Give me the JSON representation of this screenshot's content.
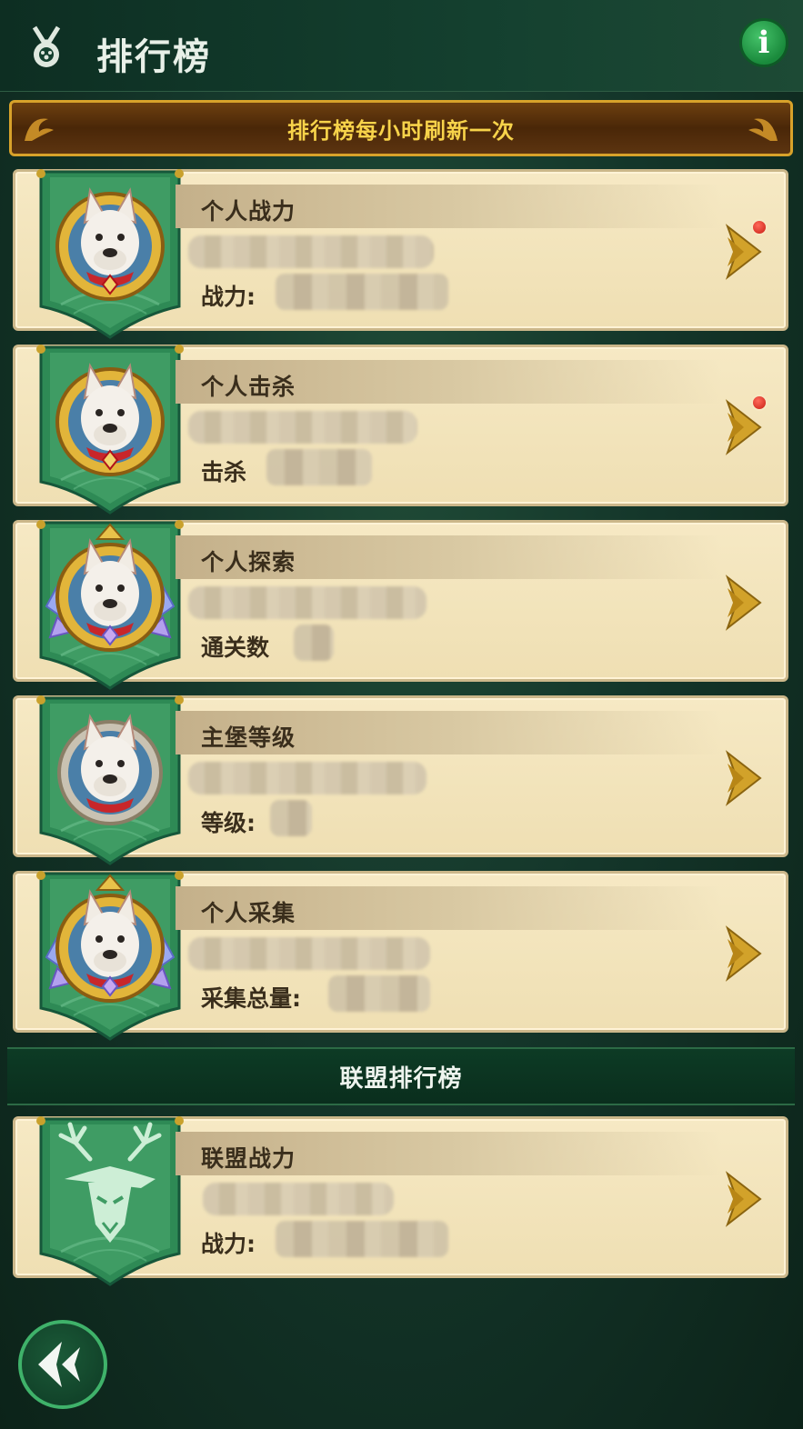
{
  "header": {
    "title": "排行榜",
    "icon": "medal-icon"
  },
  "info_button": {
    "label": "i"
  },
  "notice": {
    "text": "排行榜每小时刷新一次"
  },
  "cards": [
    {
      "name": "个人战力",
      "stat_label": "战力:",
      "avatar": "dog-avatar-gold-frame",
      "has_red_dot": true
    },
    {
      "name": "个人击杀",
      "stat_label": "击杀",
      "avatar": "dog-avatar-gold-frame",
      "has_red_dot": true
    },
    {
      "name": "个人探索",
      "stat_label": "通关数",
      "avatar": "dog-avatar-crystal-frame",
      "has_red_dot": false
    },
    {
      "name": "主堡等级",
      "stat_label": "等级:",
      "avatar": "dog-avatar-plain-frame",
      "has_red_dot": false
    },
    {
      "name": "个人采集",
      "stat_label": "采集总量:",
      "avatar": "dog-avatar-crystal-frame",
      "has_red_dot": false
    }
  ],
  "alliance_section": {
    "title": "联盟排行榜"
  },
  "alliance_cards": [
    {
      "name": "联盟战力",
      "stat_label": "战力:",
      "avatar": "deer-emblem",
      "has_red_dot": false
    }
  ],
  "colors": {
    "accent_gold": "#f7d34a",
    "bg_green": "#14362a",
    "card_bg": "#f6e9c4"
  }
}
